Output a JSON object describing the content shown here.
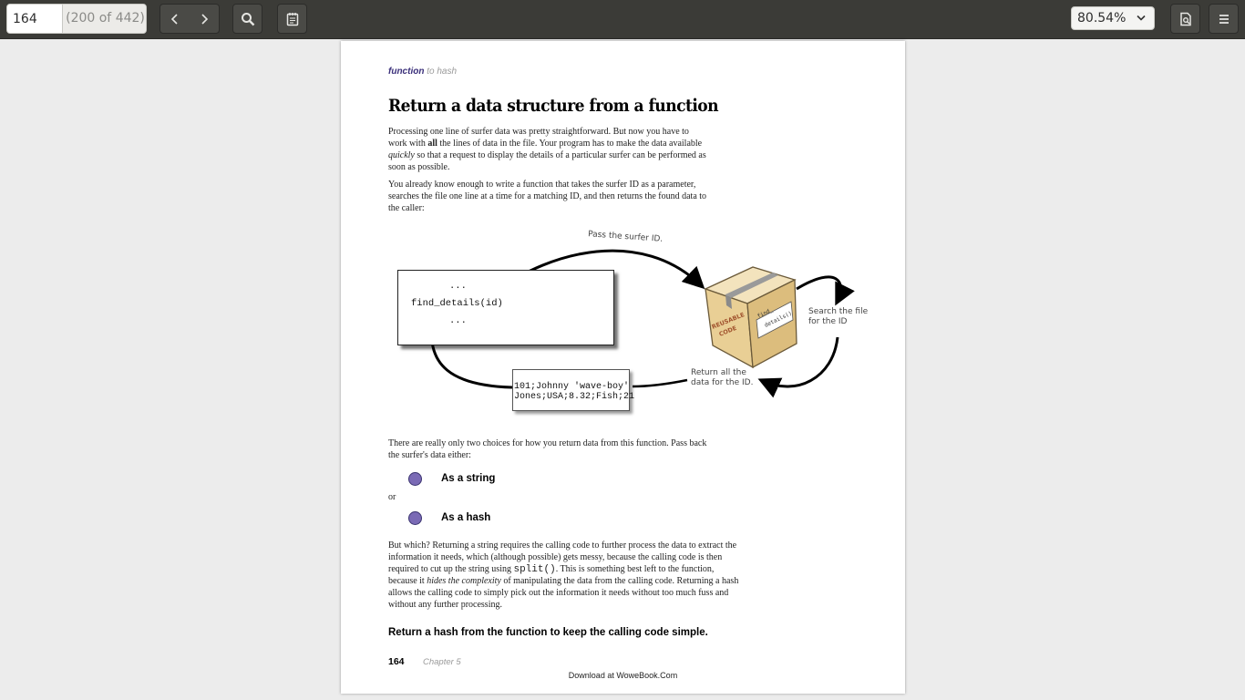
{
  "toolbar": {
    "page_number": "164",
    "page_total": "(200 of 442)",
    "zoom": "80.54%",
    "icons": [
      "chevron-left-icon",
      "chevron-right-icon",
      "search-icon",
      "annotations-icon",
      "document-properties-icon",
      "menu-icon"
    ]
  },
  "page": {
    "running_head_a": "function",
    "running_head_b": "to hash",
    "title": "Return a data structure from a function",
    "para1": [
      {
        "t": "Processing one line of surfer data was pretty straightforward. But now you have to work with "
      },
      {
        "t": "all",
        "style": "bold"
      },
      {
        "t": " the lines of data in the file. Your program has to make the data available "
      },
      {
        "t": "quickly",
        "style": "italic"
      },
      {
        "t": " so that a request to display the details of a particular surfer can be performed as soon as possible."
      }
    ],
    "para2": "You already know enough to write a function that takes the surfer ID as a parameter, searches the file one line at a time for a matching ID, and then returns the found data to the caller:",
    "diagram": {
      "code_lines": [
        "...",
        "find_details(id)",
        "..."
      ],
      "data_lines": [
        "101;Johnny 'wave-boy'",
        "Jones;USA;8.32;Fish;21"
      ],
      "label_pass": "Pass the surfer ID.",
      "label_search_1": "Search the file",
      "label_search_2": "for the ID",
      "label_return_1": "Return all the",
      "label_return_2": "data for the ID.",
      "box_label_1": "REUSABLE",
      "box_label_2": "CODE",
      "box_tag_1": "find_",
      "box_tag_2": "details()"
    },
    "para3": "There are really only two choices for how you return data from this function. Pass back the surfer's data either:",
    "option1": "As a string",
    "or": "or",
    "option2": "As a hash",
    "para4": [
      {
        "t": "But which? Returning a string requires the calling code to further process the data to extract the information it needs, which (although possible) gets messy, because the calling code is then required to cut up the string using "
      },
      {
        "t": "split()",
        "style": "mono"
      },
      {
        "t": ". This is something best left to the function, because it "
      },
      {
        "t": "hides the complexity",
        "style": "italic"
      },
      {
        "t": " of manipulating the data from the calling code. Returning a hash allows the calling code to simply pick out the information it needs without too much fuss and without any further processing."
      }
    ],
    "conclusion": "Return a hash from the function to keep the calling code simple.",
    "folio_number": "164",
    "folio_chapter": "Chapter 5",
    "download_note": "Download at WoweBook.Com"
  }
}
